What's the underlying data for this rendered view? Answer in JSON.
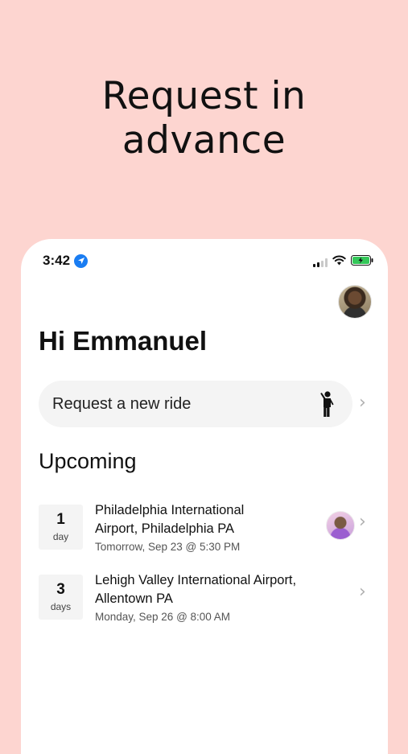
{
  "hero": {
    "line1": "Request in",
    "line2": "advance"
  },
  "status_bar": {
    "time": "3:42"
  },
  "greeting": "Hi Emmanuel",
  "request": {
    "label": "Request a new ride"
  },
  "upcoming": {
    "title": "Upcoming",
    "trips": [
      {
        "count": "1",
        "unit": "day",
        "destination_line1": "Philadelphia International",
        "destination_line2": "Airport, Philadelphia PA",
        "when": "Tomorrow, Sep 23 @ 5:30 PM"
      },
      {
        "count": "3",
        "unit": "days",
        "destination_line1": "Lehigh Valley International Airport,",
        "destination_line2": "Allentown PA",
        "when": "Monday, Sep 26 @ 8:00 AM"
      }
    ]
  },
  "colors": {
    "background": "#fdd5d0",
    "card": "#ffffff",
    "location_blue": "#1a7df2",
    "battery_green": "#34c759"
  },
  "icons": {
    "location": "location-arrow-icon",
    "signal": "cellular-signal-icon",
    "wifi": "wifi-icon",
    "battery": "battery-charging-icon",
    "person": "person-waving-icon",
    "chevron": "chevron-right-icon"
  }
}
